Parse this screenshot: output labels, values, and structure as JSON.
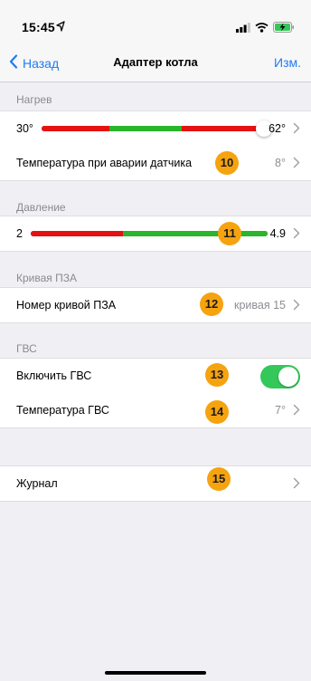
{
  "status_bar": {
    "time": "15:45",
    "location_icon": "location-arrow-icon",
    "icons": [
      "signal-icon",
      "wifi-icon",
      "battery-charging-icon"
    ],
    "battery_color": "#34c759"
  },
  "nav": {
    "back_label": "Назад",
    "title": "Адаптер котла",
    "edit_label": "Изм.",
    "accent_color": "#1f7bf6"
  },
  "heating": {
    "header": "Нагрев",
    "range": {
      "min_label": "30°",
      "max_label": "62°",
      "segments": [
        "#e41212",
        "#2bb52b",
        "#e41212"
      ]
    },
    "sensor_fault_label": "Температура при аварии датчика",
    "sensor_fault_value": "8°",
    "badge": "10"
  },
  "pressure": {
    "header": "Давление",
    "range": {
      "min_label": "2",
      "max_label": "4.9",
      "segments": [
        "#e41212",
        "#2bb52b"
      ],
      "thumb_level": 0.92
    },
    "badge": "11"
  },
  "curve": {
    "header": "Кривая ПЗА",
    "label": "Номер кривой ПЗА",
    "value": "кривая 15",
    "badge": "12"
  },
  "dhw": {
    "header": "ГВС",
    "enable_label": "Включить ГВС",
    "enabled": true,
    "enable_badge": "13",
    "temp_label": "Температура ГВС",
    "temp_value": "7°",
    "temp_badge": "14"
  },
  "journal": {
    "label": "Журнал",
    "badge": "15"
  }
}
